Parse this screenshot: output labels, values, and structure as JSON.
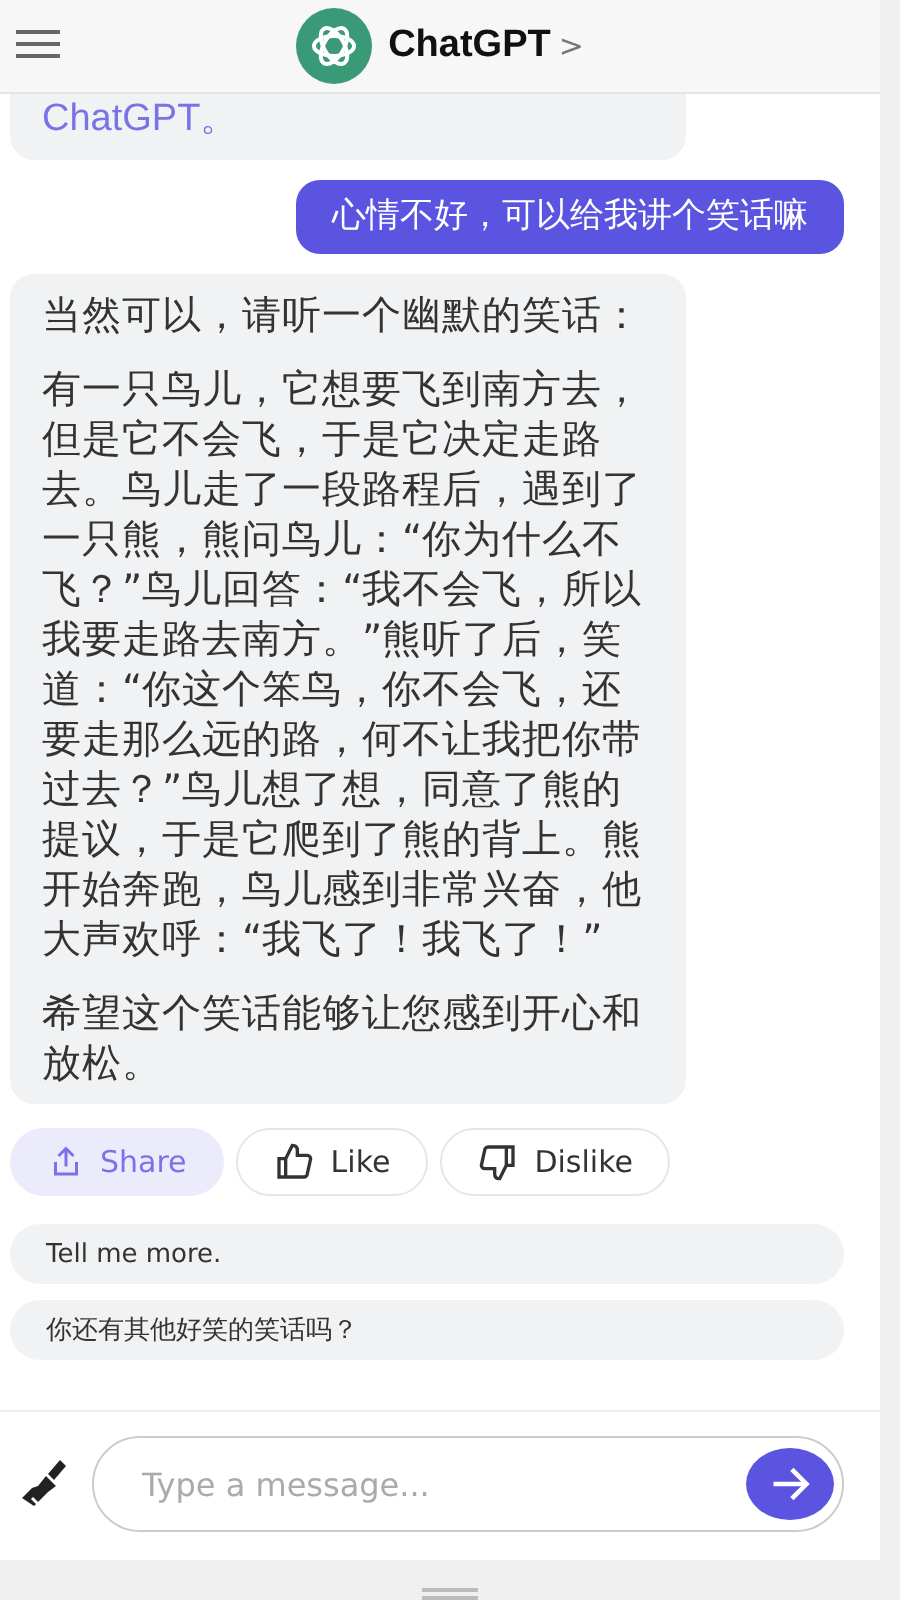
{
  "header": {
    "title": "ChatGPT",
    "chevron": ">"
  },
  "messages": [
    {
      "kind": "link",
      "paragraphs": [
        "ChatGPT。"
      ]
    },
    {
      "kind": "user",
      "paragraphs": [
        "心情不好，可以给我讲个笑话嘛"
      ]
    },
    {
      "kind": "assistant",
      "paragraphs": [
        "当然可以，请听一个幽默的笑话：",
        "有一只鸟儿，它想要飞到南方去，但是它不会飞，于是它决定走路去。鸟儿走了一段路程后，遇到了一只熊，熊问鸟儿：“你为什么不飞？”鸟儿回答：“我不会飞，所以我要走路去南方。”熊听了后，笑道：“你这个笨鸟，你不会飞，还要走那么远的路，何不让我把你带过去？”鸟儿想了想，同意了熊的提议，于是它爬到了熊的背上。熊开始奔跑，鸟儿感到非常兴奋，他大声欢呼：“我飞了！我飞了！”",
        "希望这个笑话能够让您感到开心和放松。"
      ]
    }
  ],
  "actions": [
    {
      "kind": "share",
      "label": "Share",
      "selected": true
    },
    {
      "kind": "like",
      "label": "Like",
      "selected": false
    },
    {
      "kind": "dislike",
      "label": "Dislike",
      "selected": false
    }
  ],
  "suggestions": [
    "Tell me more.",
    "你还有其他好笑的笑话吗？"
  ],
  "input": {
    "placeholder": "Type a message..."
  }
}
